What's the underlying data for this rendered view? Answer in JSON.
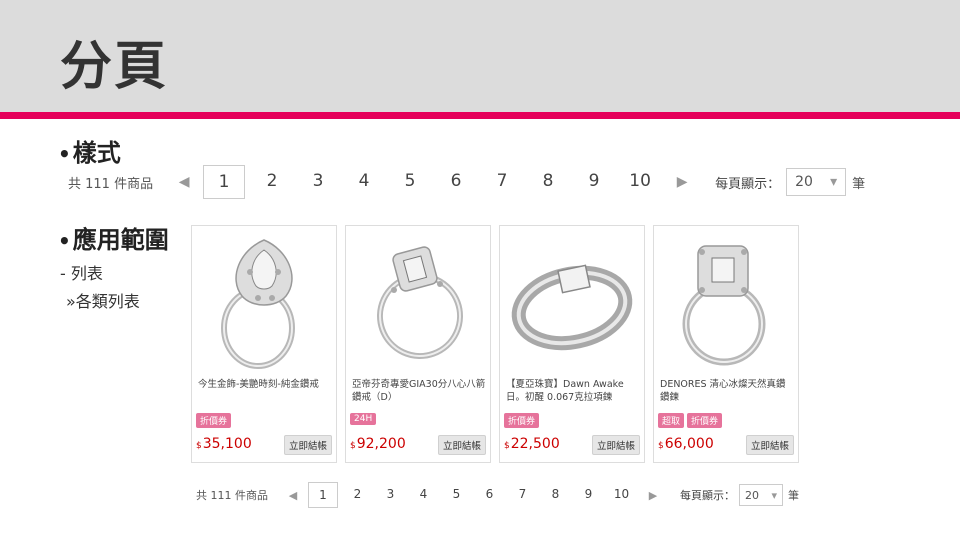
{
  "slide": {
    "title": "分頁",
    "bullets": {
      "style": "樣式",
      "scope": "應用範圍",
      "dot": "•"
    },
    "sub1": "- 列表",
    "sub2": "»各類列表"
  },
  "pager": {
    "count_text": "共 111 件商品",
    "prev_icon": "◀",
    "next_icon": "▶",
    "pages": [
      "1",
      "2",
      "3",
      "4",
      "5",
      "6",
      "7",
      "8",
      "9",
      "10"
    ],
    "current": "1",
    "per_page_label": "每頁顯示：",
    "per_page_value": "20",
    "caret_icon": "▾",
    "unit": "筆"
  },
  "products": [
    {
      "name": "今生金飾-美艷時刻-純金鑽戒",
      "tags": [
        "折價券"
      ],
      "currency": "$",
      "price": "35,100",
      "buy": "立即結帳"
    },
    {
      "name": "亞帝芬奇專愛GIA30分八心八箭鑽戒（D）",
      "tags": [
        "24H"
      ],
      "currency": "$",
      "price": "92,200",
      "buy": "立即結帳"
    },
    {
      "name": "【夏亞珠寶】Dawn Awake 日。初醒 0.067克拉項鍊",
      "tags": [
        "折價券"
      ],
      "currency": "$",
      "price": "22,500",
      "buy": "立即結帳"
    },
    {
      "name": "DENORES 清心冰燦天然真鑽鑽鍊",
      "tags": [
        "超取",
        "折價券"
      ],
      "currency": "$",
      "price": "66,000",
      "buy": "立即結帳"
    }
  ],
  "colors": {
    "accent": "#e5005a",
    "title_band": "#dcdcdc",
    "price": "#cc0000",
    "tag": "#e6739b"
  }
}
